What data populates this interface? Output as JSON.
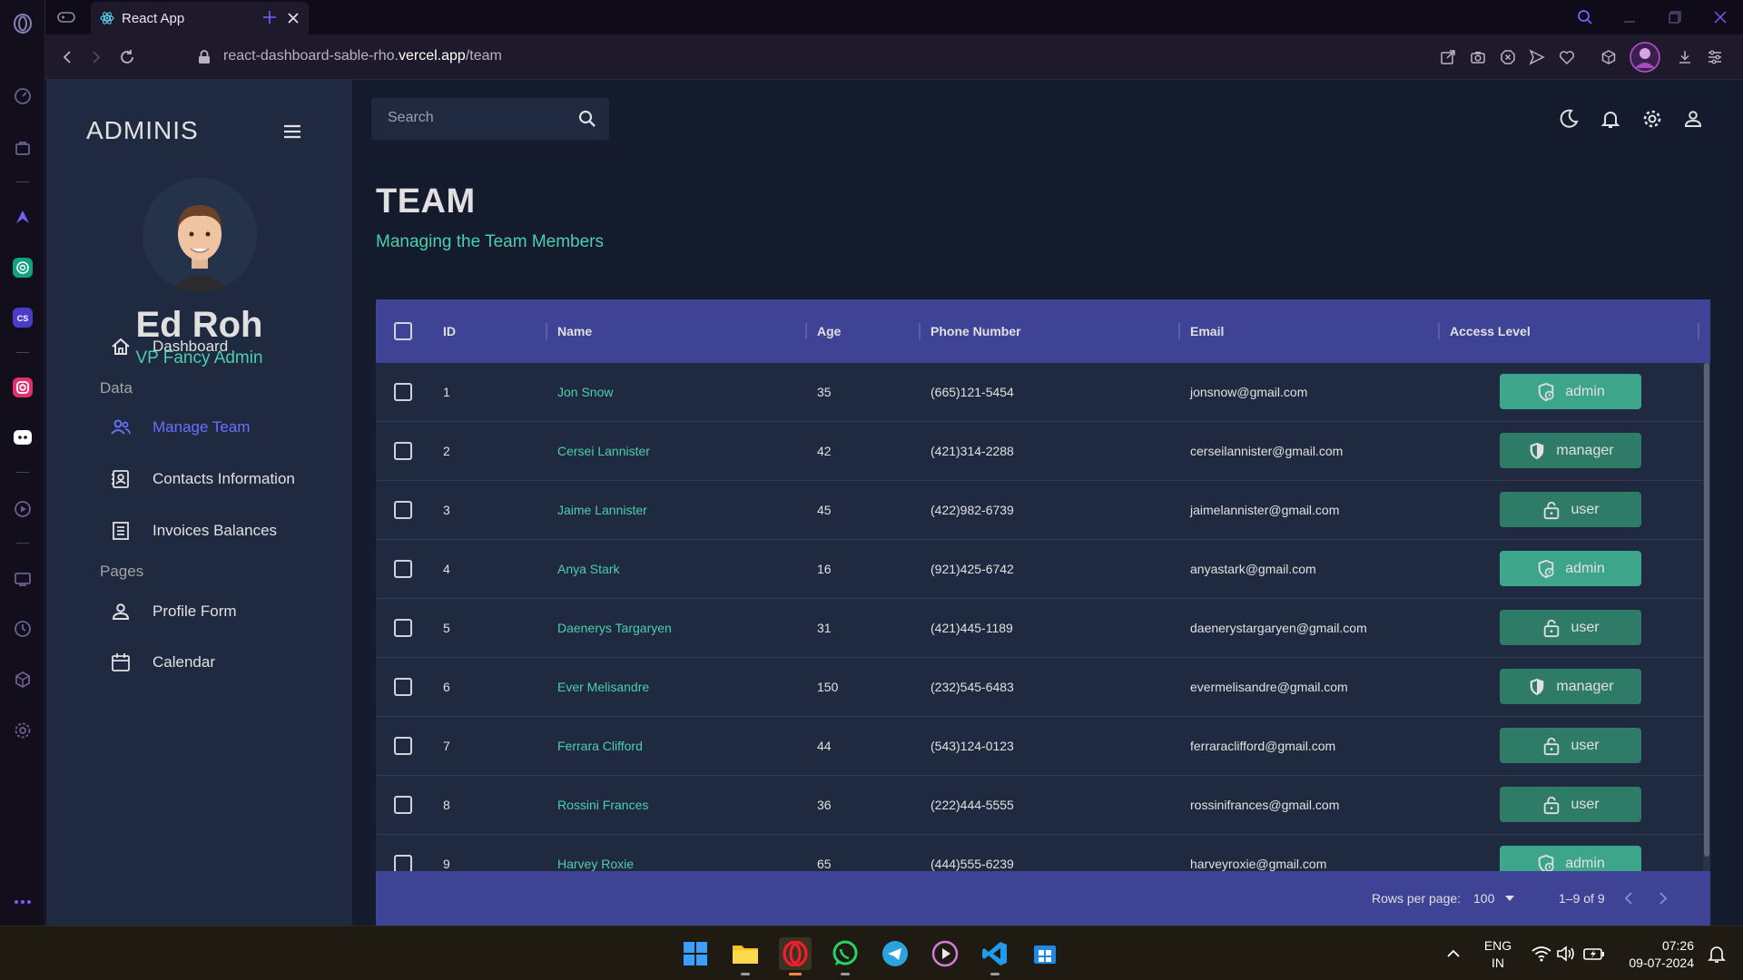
{
  "browser": {
    "tab_title": "React App",
    "url_prefix": "react-dashboard-sable-rho.",
    "url_host": "vercel.app",
    "url_path": "/team"
  },
  "sidebar": {
    "brand": "ADMINIS",
    "user_name": "Ed Roh",
    "user_role": "VP Fancy Admin",
    "items": [
      {
        "label": "Dashboard",
        "icon": "home-icon"
      },
      {
        "label": "Manage Team",
        "icon": "people-icon",
        "active": true
      },
      {
        "label": "Contacts Information",
        "icon": "contacts-icon"
      },
      {
        "label": "Invoices Balances",
        "icon": "receipt-icon"
      },
      {
        "label": "Profile Form",
        "icon": "person-icon"
      },
      {
        "label": "Calendar",
        "icon": "calendar-icon"
      }
    ],
    "sections": {
      "data": "Data",
      "pages": "Pages"
    }
  },
  "topbar": {
    "search_placeholder": "Search"
  },
  "page": {
    "title": "TEAM",
    "subtitle": "Managing the Team Members"
  },
  "table": {
    "columns": [
      "ID",
      "Name",
      "Age",
      "Phone Number",
      "Email",
      "Access Level"
    ],
    "rows": [
      {
        "id": "1",
        "name": "Jon Snow",
        "age": "35",
        "phone": "(665)121-5454",
        "email": "jonsnow@gmail.com",
        "access": "admin"
      },
      {
        "id": "2",
        "name": "Cersei Lannister",
        "age": "42",
        "phone": "(421)314-2288",
        "email": "cerseilannister@gmail.com",
        "access": "manager"
      },
      {
        "id": "3",
        "name": "Jaime Lannister",
        "age": "45",
        "phone": "(422)982-6739",
        "email": "jaimelannister@gmail.com",
        "access": "user"
      },
      {
        "id": "4",
        "name": "Anya Stark",
        "age": "16",
        "phone": "(921)425-6742",
        "email": "anyastark@gmail.com",
        "access": "admin"
      },
      {
        "id": "5",
        "name": "Daenerys Targaryen",
        "age": "31",
        "phone": "(421)445-1189",
        "email": "daenerystargaryen@gmail.com",
        "access": "user"
      },
      {
        "id": "6",
        "name": "Ever Melisandre",
        "age": "150",
        "phone": "(232)545-6483",
        "email": "evermelisandre@gmail.com",
        "access": "manager"
      },
      {
        "id": "7",
        "name": "Ferrara Clifford",
        "age": "44",
        "phone": "(543)124-0123",
        "email": "ferraraclifford@gmail.com",
        "access": "user"
      },
      {
        "id": "8",
        "name": "Rossini Frances",
        "age": "36",
        "phone": "(222)444-5555",
        "email": "rossinifrances@gmail.com",
        "access": "user"
      },
      {
        "id": "9",
        "name": "Harvey Roxie",
        "age": "65",
        "phone": "(444)555-6239",
        "email": "harveyroxie@gmail.com",
        "access": "admin"
      }
    ],
    "footer": {
      "rows_per_page_label": "Rows per page:",
      "rows_per_page_value": "100",
      "range": "1–9 of 9"
    }
  },
  "taskbar": {
    "lang_top": "ENG",
    "lang_bottom": "IN",
    "time": "07:26",
    "date": "09-07-2024"
  },
  "colors": {
    "accent_green": "#4cceac",
    "header_blue": "#3e4396",
    "active_purple": "#6870fa",
    "badge_admin": "#3da58a",
    "badge_other": "#2e7c67"
  }
}
